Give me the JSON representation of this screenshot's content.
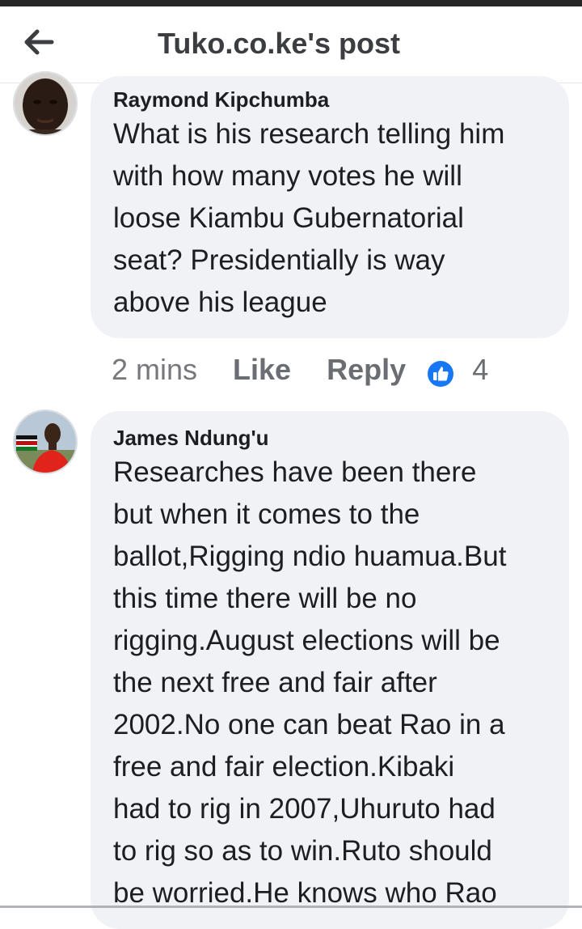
{
  "header": {
    "title": "Tuko.co.ke's post",
    "back_icon": "arrow-left-icon"
  },
  "comments": [
    {
      "author": "Raymond Kipchumba",
      "avatar_icon": "avatar-photo",
      "text": "What is his research telling him\nwith how many votes he will\nloose Kiambu Gubernatorial\nseat? Presidentially is way\nabove his league",
      "time": "2 mins",
      "like_label": "Like",
      "reply_label": "Reply",
      "reaction_icon": "thumbs-up-icon",
      "reaction_count": "4"
    },
    {
      "author": "James Ndung'u",
      "avatar_icon": "avatar-photo",
      "text": "Researches have been there\nbut when it comes to the\nballot,Rigging ndio huamua.But\nthis time there will be no\nrigging.August elections will be\nthe next free and fair after\n2002.No one can beat Rao in a\nfree and fair election.Kibaki\nhad to rig in 2007,Uhuruto had\nto rig so as to win.Ruto should\nbe worried.He knows who Rao"
    }
  ],
  "colors": {
    "bubble": "#f0f2f5",
    "text": "#1c1e21",
    "muted": "#6a6d72",
    "like_badge": "#1877f2"
  }
}
